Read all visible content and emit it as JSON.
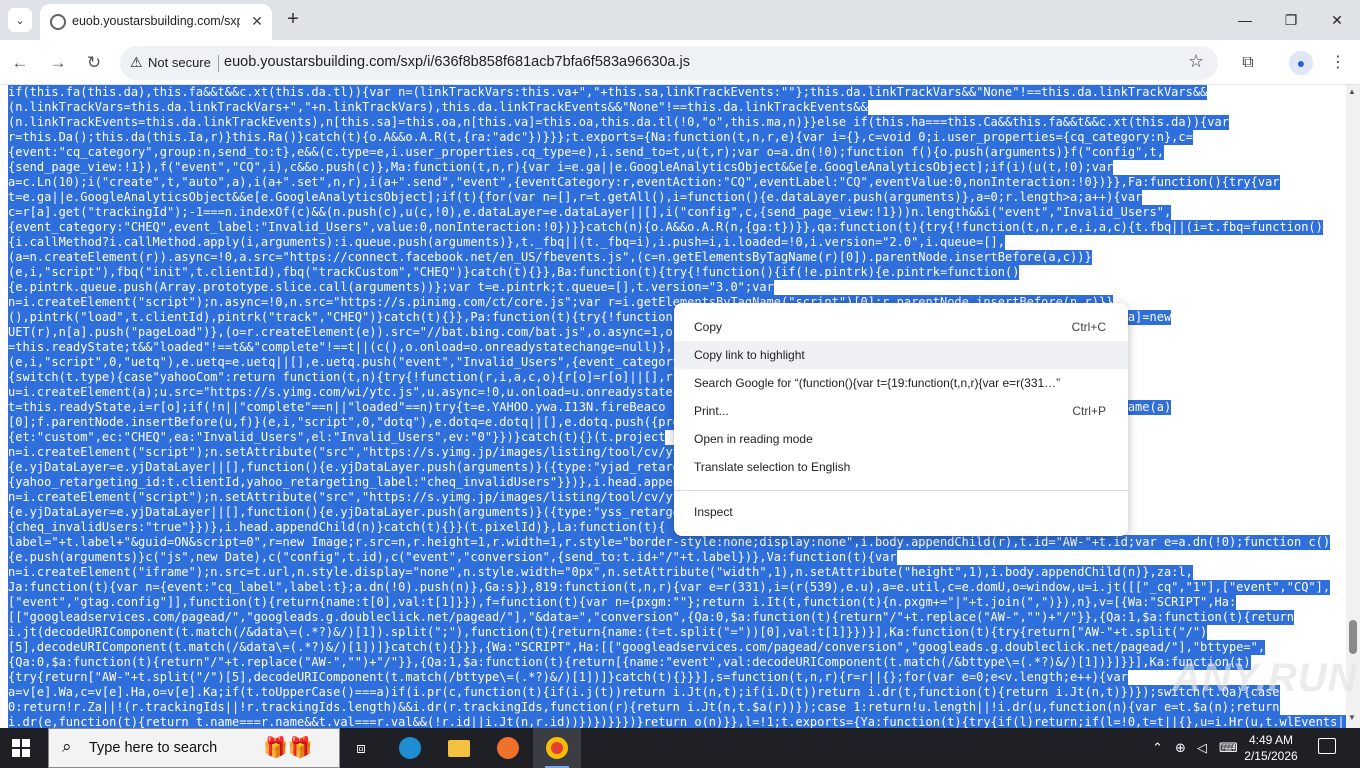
{
  "browser": {
    "tab_title": "euob.youstarsbuilding.com/sxp",
    "tab_close": "✕",
    "new_tab": "+",
    "security_label": "Not secure",
    "url": "euob.youstarsbuilding.com/sxp/i/636f8b858f681acb7bfa6f583a96630a.js"
  },
  "code_lines": [
    "if(this.fa(this.da),this.fa&&t&&c.xt(this.da.tl)){var n=(linkTrackVars:this.va+\",\"+this.sa,linkTrackEvents:\"\"};this.da.linkTrackVars&&\"None\"!==this.da.linkTrackVars&&",
    "(n.linkTrackVars=this.da.linkTrackVars+\",\"+n.linkTrackVars),this.da.linkTrackEvents&&\"None\"!==this.da.linkTrackEvents&&",
    "(n.linkTrackEvents=this.da.linkTrackEvents),n[this.sa]=this.oa,n[this.va]=this.oa,this.da.tl(!0,\"o\",this.ma,n)}}else if(this.ha===this.Ca&&this.fa&&t&&c.xt(this.da)){var",
    "r=this.Da();this.da(this.Ia,r)}this.Ra()}catch(t){o.A&&o.A.R(t,{ra:\"adc\"})}}};t.exports={Na:function(t,n,r,e){var i={},c=void 0;i.user_properties={cq_category:n},c=",
    "{event:\"cq_category\",group:n,send_to:t},e&&(c.type=e,i.user_properties.cq_type=e),i.send_to=t,u(t,r);var o=a.dn(!0);function f(){o.push(arguments)}f(\"config\",t,",
    "{send_page_view:!1}),f(\"event\",\"CQ\",i),c&&o.push(c)},Ma:function(t,n,r){var i=e.ga||e.GoogleAnalyticsObject&&e[e.GoogleAnalyticsObject];if(i)(u(t,!0);var",
    "a=c.Ln(10);i(\"create\",t,\"auto\",a),i(a+\".set\",n,r),i(a+\".send\",\"event\",{eventCategory:r,eventAction:\"CQ\",eventLabel:\"CQ\",eventValue:0,nonInteraction:!0})}},Fa:function(){try{var",
    "t=e.ga||e.GoogleAnalyticsObject&&e[e.GoogleAnalyticsObject];if(t){for(var n=[],r=t.getAll(),i=function(){e.dataLayer.push(arguments)},a=0;r.length>a;a++){var",
    "c=r[a].get(\"trackingId\");-1===n.indexOf(c)&&(n.push(c),u(c,!0),e.dataLayer=e.dataLayer||[],i(\"config\",c,{send_page_view:!1}))n.length&&i(\"event\",\"Invalid_Users\",",
    "{event_category:\"CHEQ\",event_label:\"Invalid_Users\",value:0,nonInteraction:!0})}}catch(n){o.A&&o.A.R(n,{ga:t})}},qa:function(t){try{!function(t,n,r,e,i,a,c){t.fbq||(i=t.fbq=function()",
    "{i.callMethod?i.callMethod.apply(i,arguments):i.queue.push(arguments)},t._fbq||(t._fbq=i),i.push=i,i.loaded=!0,i.version=\"2.0\",i.queue=[],",
    "(a=n.createElement(r)).async=!0,a.src=\"https://connect.facebook.net/en_US/fbevents.js\",(c=n.getElementsByTagName(r)[0]).parentNode.insertBefore(a,c))}",
    "(e,i,\"script\"),fbq(\"init\",t.clientId),fbq(\"trackCustom\",\"CHEQ\")}catch(t){}},Ba:function(t){try{!function(){if(!e.pintrk){e.pintrk=function()",
    "{e.pintrk.queue.push(Array.prototype.slice.call(arguments))};var t=e.pintrk;t.queue=[],t.version=\"3.0\";var",
    "n=i.createElement(\"script\");n.async=!0,n.src=\"https://s.pinimg.com/ct/core.js\";var r=i.getElementsByTagName(\"script\")[0];r.parentNode.insertBefore(n,r)}}",
    "(),pintrk(\"load\",t.clientId),pintrk(\"track\",\"CHEQ\")}catch(t){}},Pa:function(t){try{!function(                                            entId};r.q=n[a],n[a]=new",
    "UET(r),n[a].push(\"pageLoad\")},(o=r.createElement(e)).src=\"//bat.bing.com/bat.js\",o.async=1,o.onl",
    "=this.readyState;t&&\"loaded\"!==t&&\"complete\"!==t||(c(),o.onload=o.onreadystatechange=null)},(u",
    "(e,i,\"script\",0,\"uetq\"),e.uetq=e.uetq||[],e.uetq.push(\"event\",\"Invalid_Users\",{event_category                                            },Ua:function(t)",
    "{switch(t.type){case\"yahooCom\":return function(t,n){try{!function(r,i,a,c,o){r[o]=r[o]||[],r[",
    "u=i.createElement(a);u.src=\"https://s.yimg.com/wi/ytc.js\",u.async=!0,u.onload=u.onreadystatec",
    "t=this.readyState,i=r[o];if(!n||\"complete\"==n||\"loaded\"==n)try{t=e.YAHOO.ywa.I13N.fireBeaco                                              .getElementsByTagName(a)",
    "[0];f.parentNode.insertBefore(u,f)}(e,i,\"script\",0,\"dotq\"),e.dotq=e.dotq||[],e.dotq.push({pro",
    "{et:\"custom\",ec:\"CHEQ\",ea:\"Invalid_Users\",el:\"Invalid_Users\",ev:\"0\"}})}catch(t){}(t.project",
    "n=i.createElement(\"script\");n.setAttribute(\"src\",\"https://s.yimg.jp/images/listing/tool/cv/yt                                         tion()",
    "{e.yjDataLayer=e.yjDataLayer||[],function(){e.yjDataLayer.push(arguments)}({type:\"yjad_retarg",
    "{yahoo_retargeting_id:t.clientId,yahoo_retargeting_label:\"cheq_invalidUsers\"}})},i.head.appendChild(n)                                    ){try{var",
    "n=i.createElement(\"script\");n.setAttribute(\"src\",\"https://s.yimg.jp/images/listing/tool/cv/yt                                         tion()",
    "{e.yjDataLayer=e.yjDataLayer||[],function(){e.yjDataLayer.push(arguments)}({type:\"yss_retarge                                          s:",
    "{cheq_invalidUsers:\"true\"}})},i.head.appendChild(n)}catch(t){}}(t.pixelId)},La:function(t){                                          s+\"/?",
    "label=\"+t.label+\"&guid=ON&script=0\",r=new Image;r.src=n,r.height=1,r.width=1,r.style=\"border-style:none;display:none\",i.body.appendChild(r),t.id=\"AW-\"+t.id;var e=a.dn(!0);function c()",
    "{e.push(arguments)}c(\"js\",new Date),c(\"config\",t.id),c(\"event\",\"conversion\",{send_to:t.id+\"/\"+t.label})},Va:function(t){var",
    "n=i.createElement(\"iframe\");n.src=t.url,n.style.display=\"none\",n.style.width=\"0px\",n.setAttribute(\"width\",1),n.setAttribute(\"height\",1),i.body.appendChild(n)},za:l,",
    "Ja:function(t){var n={event:\"cq_label\",label:t};a.dn(!0).push(n)},Ga:s}},819:function(t,n,r){var e=r(331),i=(r(539),e.u),a=e.util,c=e.domU,o=window,u=i.jt([[\"_cq\",\"1\"],[\"event\",\"CQ\"],",
    "[\"event\",\"gtag.config\"]],function(t){return{name:t[0],val:t[1]}}),f=function(t){var n={pxgm:\"\"};return i.It(t,function(t){n.pxgm+=\"|\"+t.join(\",\")}),n},v=[{Wa:\"SCRIPT\",Ha:",
    "[[\"googleadservices.com/pagead/\",\"googleads.g.doubleclick.net/pagead/\"],\"&data=\",\"conversion\",{Qa:0,$a:function(t){return\"/\"+t.replace(\"AW-\",\"\")+\"/\"}},{Qa:1,$a:function(t){return",
    "i.jt(decodeURIComponent(t.match(/&data\\=(.*?)&/)[1]).split(\";\"),function(t){return{name:(t=t.split(\"=\"))[0],val:t[1]}})}],Ka:function(t){try{return[\"AW-\"+t.split(\"/\")",
    "[5],decodeURIComponent(t.match(/&data\\=(.*?)&/)[1])]}catch(t){}}},{Wa:\"SCRIPT\",Ha:[[\"googleadservices.com/pagead/conversion\",\"googleads.g.doubleclick.net/pagead/\"],\"bttype=\",",
    "{Qa:0,$a:function(t){return\"/\"+t.replace(\"AW-\",\"\")+\"/\"}},{Qa:1,$a:function(t){return[{name:\"event\",val:decodeURIComponent(t.match(/&bttype\\=(.*?)&/)[1])}]}}],Ka:function(t)",
    "{try{return[\"AW-\"+t.split(\"/\")[5],decodeURIComponent(t.match(/bttype\\=(.*?)&/)[1])]}catch(t){}}}],s=function(t,n,r){r=r||{};for(var e=0;e<v.length;e++){var",
    "a=v[e].Wa,c=v[e].Ha,o=v[e].Ka;if(t.toUpperCase()===a)if(i.pr(c,function(t){if(i.j(t))return i.Jt(n,t);if(i.D(t))return i.dr(t,function(t){return i.Jt(n,t)})});switch(t.Qa){case",
    "0:return!r.Za||!(r.trackingIds||!r.trackingIds.length)&&i.dr(r.trackingIds,function(r){return i.Jt(n,t.$a(r))});case 1:return!u.length||!i.dr(u,function(n){var e=t.$a(n);return",
    "i.dr(e,function(t){return t.name===r.name&&t.val===r.val&&(!r.id||i.Jt(n,r.id))})})}}})}return o(n)}},l=!1;t.exports={Ya:function(t){try{if(l)return;if(l=!0,t=t||{},u=i.Hr(u,t.wlEvents||"
  ],
  "context_menu": {
    "copy": "Copy",
    "copy_shortcut": "Ctrl+C",
    "copy_link": "Copy link to highlight",
    "search_google": "Search Google for “(function(){var t={19:function(t,n,r){var e=r(331…”",
    "print": "Print...",
    "print_shortcut": "Ctrl+P",
    "reading_mode": "Open in reading mode",
    "translate": "Translate selection to English",
    "inspect": "Inspect"
  },
  "watermark": "ANY.RUN",
  "taskbar": {
    "search_placeholder": "Type here to search",
    "time": "4:49 AM",
    "date": "2/15/2026"
  },
  "colors": {
    "selection": "#2f6fdb",
    "tabbar": "#dfe3e8",
    "taskbar": "#1e2026"
  }
}
